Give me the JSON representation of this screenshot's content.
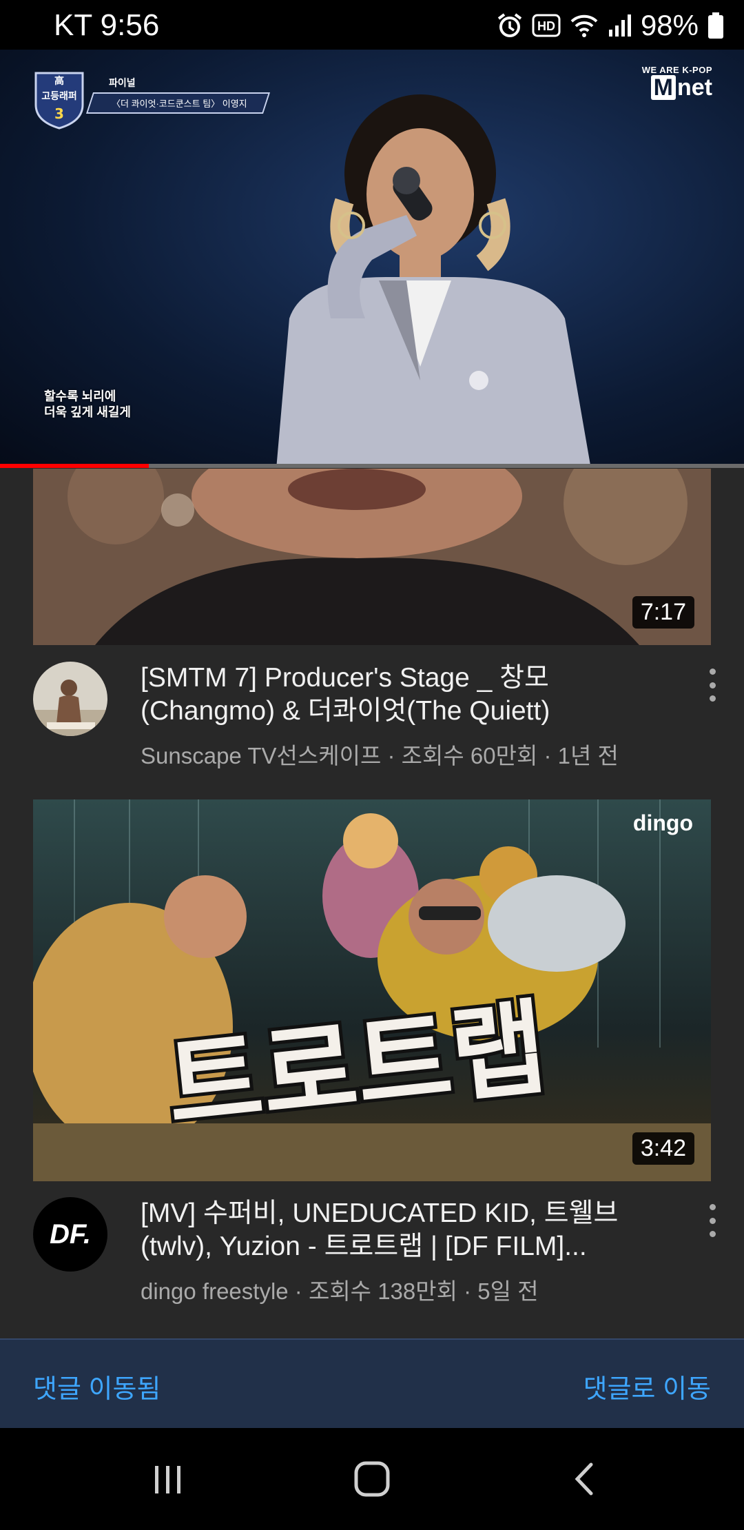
{
  "status_bar": {
    "carrier_time": "KT 9:56",
    "hd_label": "HD",
    "battery": "98%",
    "icons": [
      "alarm-icon",
      "hd-icon",
      "wifi-icon",
      "signal-icon",
      "battery-icon"
    ]
  },
  "player": {
    "show_badge": {
      "logo_top": "高",
      "logo_name": "고등래퍼",
      "logo_number": "3",
      "line1": "파이널",
      "line2": "〈더 콰이엇·코드쿤스트 팀〉 이영지"
    },
    "channel_mark": {
      "top": "WE ARE K-POP",
      "m": "M",
      "rest": "net"
    },
    "caption_lines": [
      "할수록 뇌리에",
      "더욱 깊게 새길게"
    ],
    "progress_fraction": 0.2
  },
  "feed": [
    {
      "duration": "7:17",
      "title": "[SMTM 7] Producer's Stage _ 창모(Changmo) & 더콰이엇(The Quiett)",
      "meta": "Sunscape TV선스케이프 · 조회수 60만회 · 1년 전"
    },
    {
      "duration": "3:42",
      "thumb_logo": "dingo",
      "thumb_title": "트로트랩",
      "avatar_text": "DF.",
      "title": "[MV] 수퍼비, UNEDUCATED KID, 트웰브(twlv), Yuzion - 트로트랩 | [DF FILM]...",
      "meta": "dingo freestyle · 조회수 138만회 · 5일 전"
    }
  ],
  "comments_bar": {
    "left_label": "댓글 이동됨",
    "right_label": "댓글로 이동"
  },
  "colors": {
    "background": "#282828",
    "accent_blue": "#3ea6ff",
    "progress_red": "#ff0000"
  }
}
